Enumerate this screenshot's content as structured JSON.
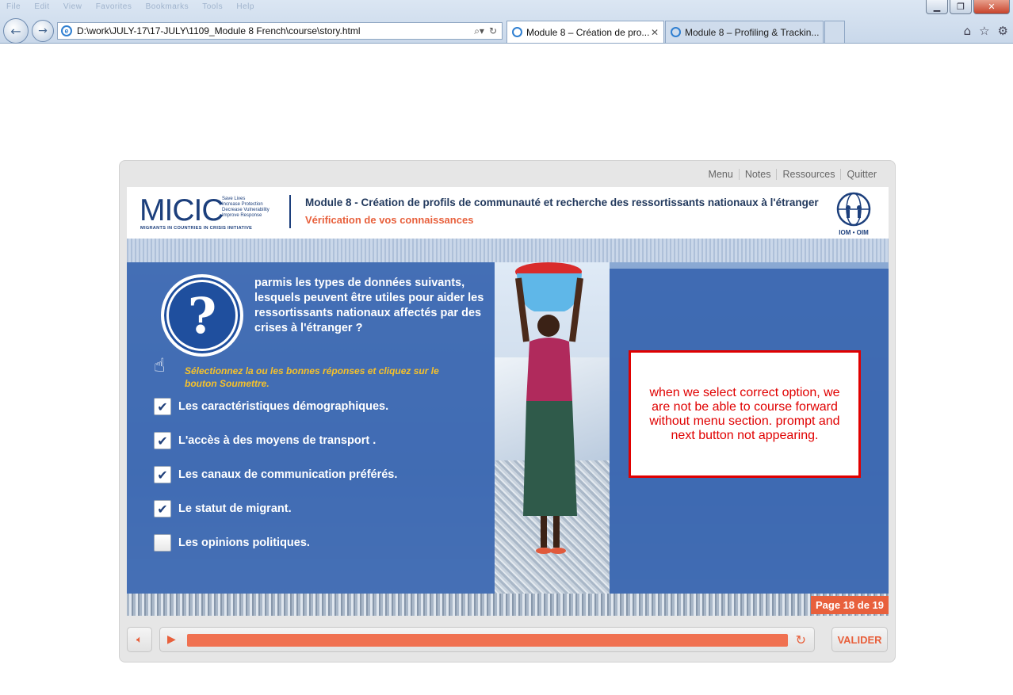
{
  "browser": {
    "menu_ghost": [
      "File",
      "Edit",
      "View",
      "Favorites",
      "Bookmarks",
      "Tools",
      "Help"
    ],
    "address_url": "D:\\work\\JULY-17\\17-JULY\\1109_Module 8 French\\course\\story.html",
    "tabs": [
      {
        "label": "Module 8 – Création de pro..."
      },
      {
        "label": "Module 8 – Profiling & Trackin..."
      }
    ]
  },
  "player": {
    "top_links": [
      "Menu",
      "Notes",
      "Ressources",
      "Quitter"
    ],
    "header": {
      "logo_text": "MICIC",
      "logo_tagline": [
        "Save Lives",
        "Increase Protection",
        "Decrease Vulnerability",
        "Improve Response"
      ],
      "logo_sub": "MIGRANTS IN COUNTRIES IN CRISIS INITIATIVE",
      "title": "Module 8 - Création de profils de communauté et recherche des ressortissants nationaux à l'étranger",
      "subtitle": "Vérification de vos connaissances",
      "iom_text": "IOM • OIM"
    },
    "question": "parmis les types de  données suivants, lesquels peuvent être utiles pour aider les ressortissants nationaux affectés par des crises à l'étranger ?",
    "instruction": "Sélectionnez la ou les bonnes réponses et cliquez sur le bouton Soumettre.",
    "options": [
      {
        "label": "Les caractéristiques démographiques.",
        "checked": true
      },
      {
        "label": "L'accès à des moyens de transport .",
        "checked": true
      },
      {
        "label": "Les canaux de communication préférés.",
        "checked": true
      },
      {
        "label": "Le statut de migrant.",
        "checked": true
      },
      {
        "label": "Les opinions politiques.",
        "checked": false
      }
    ],
    "page_number": "Page 18 de 19",
    "progress": 1.0,
    "submit_label": "VALIDER"
  },
  "annotation": {
    "text": "when we select correct option, we are not be able to course forward without menu section. prompt and next button not appearing."
  },
  "colors": {
    "accent": "#e8603c",
    "slide_blue": "#3a66b0",
    "note_red": "#e00000"
  }
}
